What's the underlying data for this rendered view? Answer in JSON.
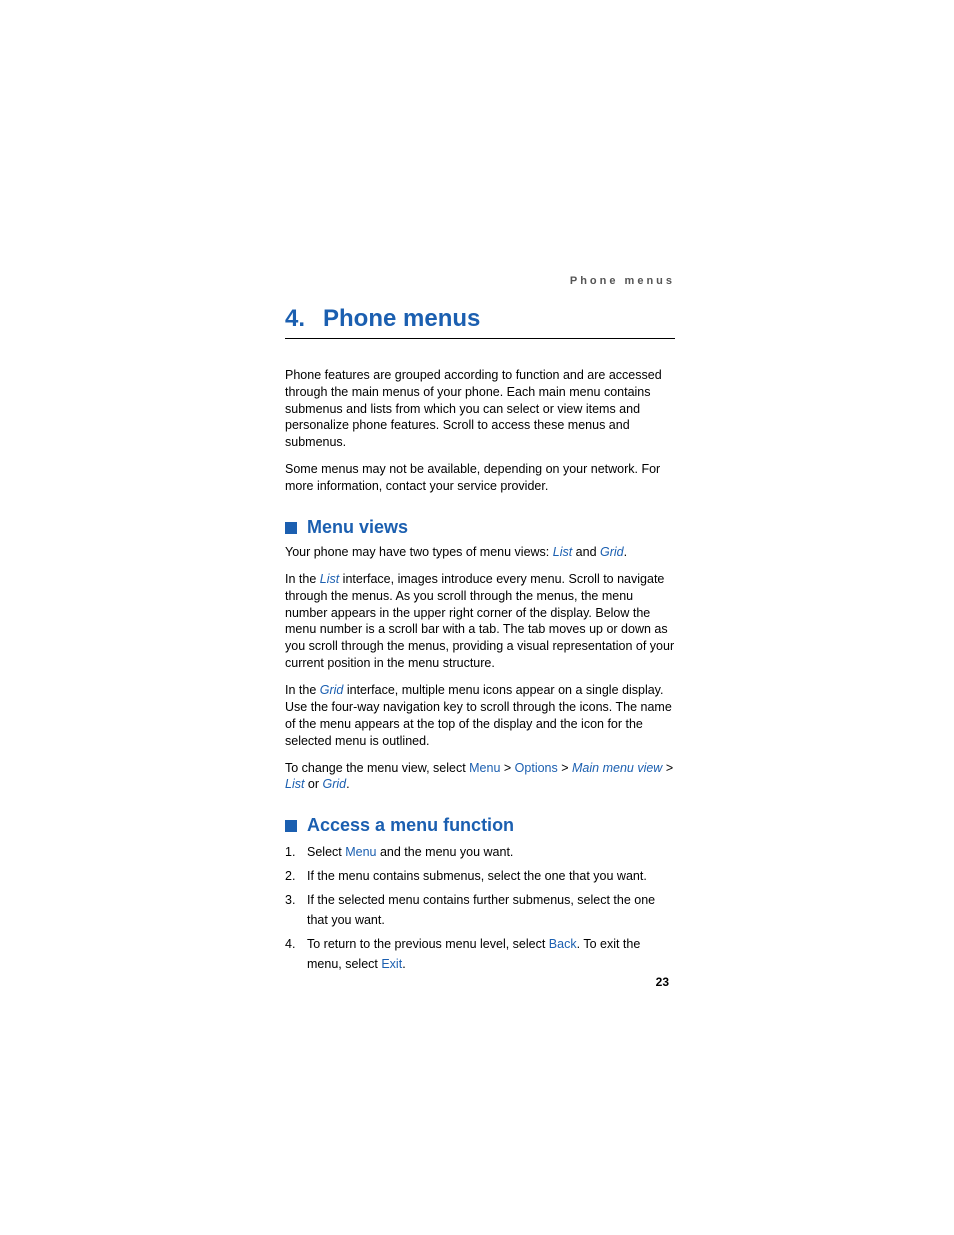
{
  "running_header": "Phone menus",
  "chapter": {
    "number": "4.",
    "title": "Phone menus"
  },
  "intro": {
    "p1": "Phone features are grouped according to function and are accessed through the main menus of your phone. Each main menu contains submenus and lists from which you can select or view items and personalize phone features. Scroll to access these menus and submenus.",
    "p2": "Some menus may not be available, depending on your network. For more information, contact your service provider."
  },
  "section1": {
    "title": "Menu views",
    "p1_a": "Your phone may have two types of menu views: ",
    "p1_list": "List",
    "p1_b": " and ",
    "p1_grid": "Grid",
    "p1_c": ".",
    "p2_a": "In the ",
    "p2_list": "List",
    "p2_b": " interface, images introduce every menu. Scroll to navigate through the menus. As you scroll through the menus, the menu number appears in the upper right corner of the display. Below the menu number is a scroll bar with a tab. The tab moves up or down as you scroll through the menus, providing a visual representation of your current position in the menu structure.",
    "p3_a": "In the ",
    "p3_grid": "Grid",
    "p3_b": " interface, multiple menu icons appear on a single display. Use the four-way navigation key to scroll through the icons. The name of the menu appears at the top of the display and the icon for the selected menu is outlined.",
    "p4_a": "To change the menu view, select ",
    "p4_menu": "Menu",
    "p4_sep1": " > ",
    "p4_options": "Options",
    "p4_sep2": " > ",
    "p4_mainview": "Main menu view",
    "p4_sep3": " > ",
    "p4_list": "List",
    "p4_or": " or ",
    "p4_grid": "Grid",
    "p4_end": "."
  },
  "section2": {
    "title": "Access a menu function",
    "steps": {
      "s1_a": "Select ",
      "s1_menu": "Menu",
      "s1_b": " and the menu you want.",
      "s2": "If the menu contains submenus, select the one that you want.",
      "s3": "If the selected menu contains further submenus, select the one that you want.",
      "s4_a": "To return to the previous menu level, select ",
      "s4_back": "Back",
      "s4_b": ". To exit the menu, select ",
      "s4_exit": "Exit",
      "s4_c": "."
    }
  },
  "page_number": "23"
}
